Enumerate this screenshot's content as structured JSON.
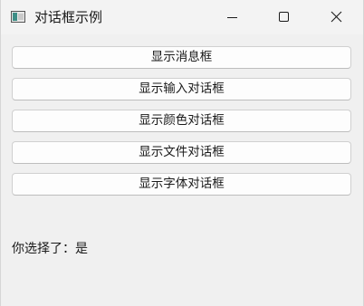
{
  "window": {
    "title": "对话框示例"
  },
  "buttons": [
    {
      "label": "显示消息框"
    },
    {
      "label": "显示输入对话框"
    },
    {
      "label": "显示颜色对话框"
    },
    {
      "label": "显示文件对话框"
    },
    {
      "label": "显示字体对话框"
    }
  ],
  "result": {
    "text": "你选择了：是"
  }
}
